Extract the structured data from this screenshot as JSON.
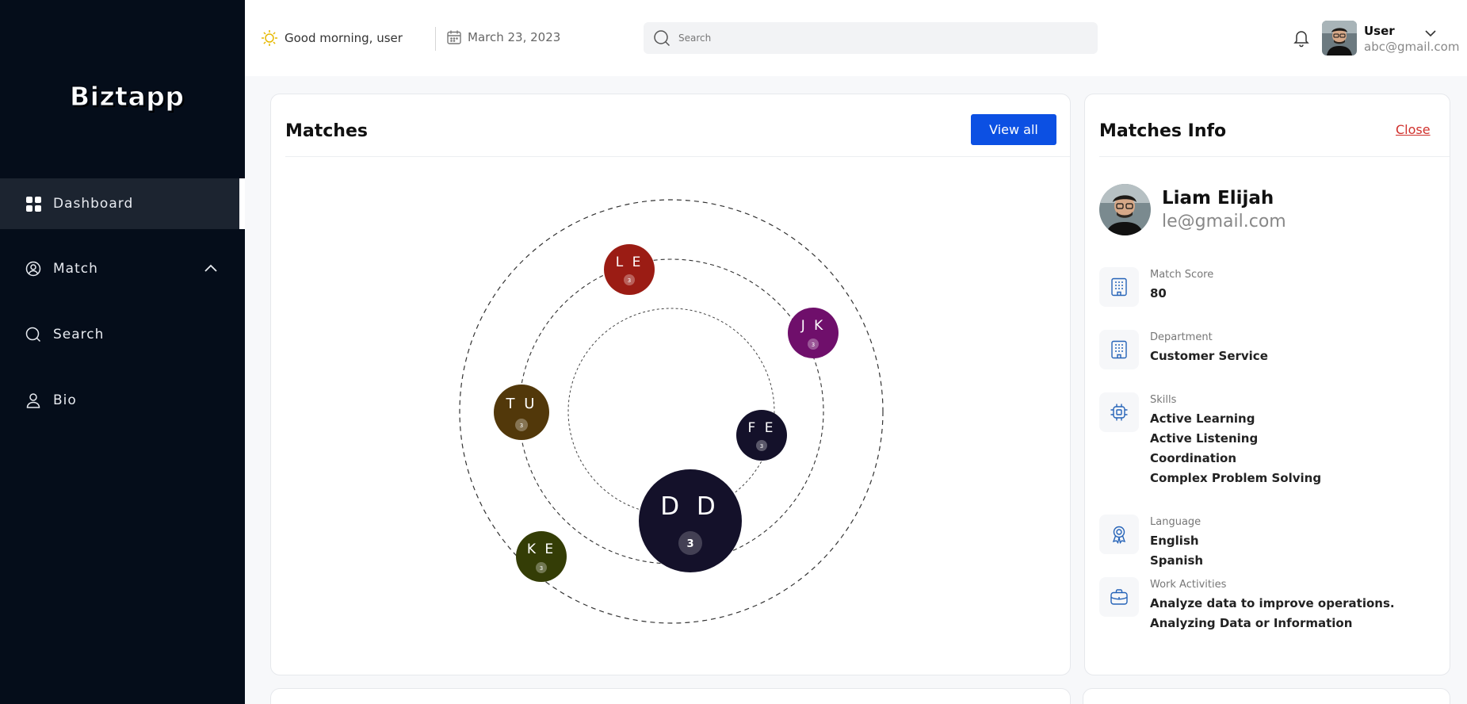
{
  "brand": {
    "logo": "Biztapp"
  },
  "sidebar": {
    "items": [
      {
        "label": "Dashboard",
        "icon": "grid-icon",
        "active": true
      },
      {
        "label": "Match",
        "icon": "user-circle-icon",
        "expanded": true
      },
      {
        "label": "Search",
        "icon": "search-icon"
      },
      {
        "label": "Bio",
        "icon": "user-icon"
      }
    ]
  },
  "topbar": {
    "greeting": "Good morning, user",
    "date": "March 23, 2023",
    "search_placeholder": "Search",
    "user": {
      "name": "User",
      "email": "abc@gmail.com"
    }
  },
  "matches": {
    "title": "Matches",
    "view_all": "View all",
    "bubbles": [
      {
        "initials": "L E",
        "count": "3",
        "color": "#9b1c14"
      },
      {
        "initials": "J K",
        "count": "3",
        "color": "#6f0f6b"
      },
      {
        "initials": "T U",
        "count": "3",
        "color": "#52380a"
      },
      {
        "initials": "F E",
        "count": "3",
        "color": "#14112a"
      },
      {
        "initials": "D D",
        "count": "3",
        "color": "#14112a"
      },
      {
        "initials": "K E",
        "count": "3",
        "color": "#343d06"
      }
    ]
  },
  "info": {
    "title": "Matches Info",
    "close": "Close",
    "name": "Liam Elijah",
    "email": "le@gmail.com",
    "match_score_label": "Match Score",
    "match_score": "80",
    "department_label": "Department",
    "department": "Customer Service",
    "skills_label": "Skills",
    "skills": [
      "Active Learning",
      "Active Listening",
      "Coordination",
      "Complex Problem Solving"
    ],
    "language_label": "Language",
    "languages": [
      "English",
      "Spanish"
    ],
    "work_label": "Work Activities",
    "work": [
      "Analyze data to improve operations.",
      "Analyzing Data or Information"
    ]
  },
  "colors": {
    "accent": "#0c50e3",
    "sidebar": "#050d1a",
    "close": "#d0312d"
  }
}
